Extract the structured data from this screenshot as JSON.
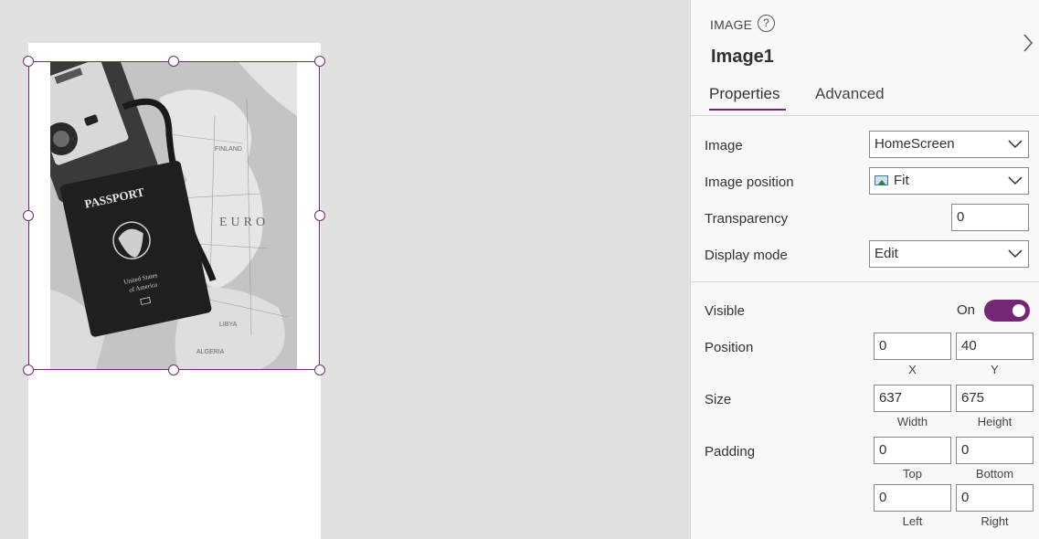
{
  "panel": {
    "control_type": "IMAGE",
    "control_name": "Image1",
    "tabs": [
      {
        "label": "Properties",
        "active": true
      },
      {
        "label": "Advanced",
        "active": false
      }
    ]
  },
  "properties": {
    "image": {
      "label": "Image",
      "value": "HomeScreen"
    },
    "image_position": {
      "label": "Image position",
      "value": "Fit",
      "icon": "image-fit-icon"
    },
    "transparency": {
      "label": "Transparency",
      "value": "0"
    },
    "display_mode": {
      "label": "Display mode",
      "value": "Edit"
    },
    "visible": {
      "label": "Visible",
      "state_text": "On",
      "on": true
    },
    "position": {
      "label": "Position",
      "x": "0",
      "y": "40",
      "x_label": "X",
      "y_label": "Y"
    },
    "size": {
      "label": "Size",
      "width": "637",
      "height": "675",
      "width_label": "Width",
      "height_label": "Height"
    },
    "padding": {
      "label": "Padding",
      "top": "0",
      "bottom": "0",
      "left": "0",
      "right": "0",
      "top_label": "Top",
      "bottom_label": "Bottom",
      "left_label": "Left",
      "right_label": "Right"
    }
  },
  "canvas": {
    "selected_image": "passport-on-map-photo",
    "photo_text": {
      "passport": "PASSPORT",
      "country": "United States of America"
    }
  },
  "colors": {
    "accent": "#742774"
  }
}
